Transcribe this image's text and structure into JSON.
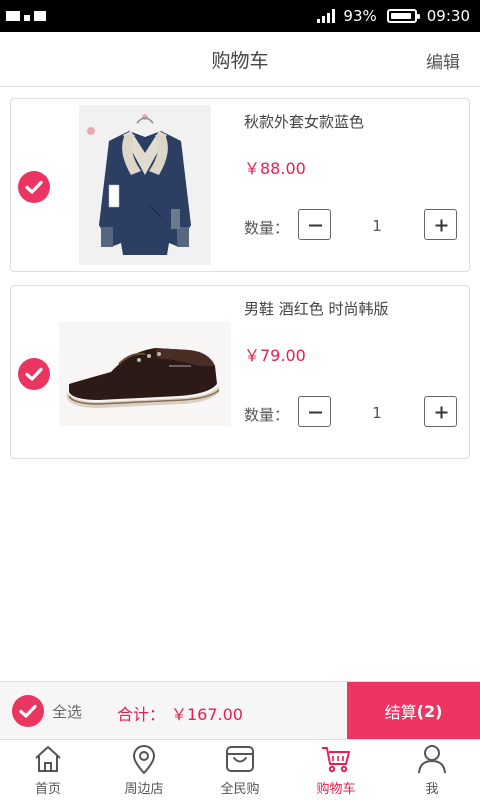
{
  "status_bar": {
    "battery_percent": "93%",
    "time": "09:30",
    "battery_level": 0.93
  },
  "header": {
    "title": "购物车",
    "edit_label": "编辑"
  },
  "cart": {
    "items": [
      {
        "name": "秋款外套女款蓝色",
        "price": "￥88.00",
        "quantity_label": "数量：",
        "quantity": "1",
        "checked": true,
        "image_icon": "blue-jacket-photo"
      },
      {
        "name": "男鞋 酒红色 时尚韩版",
        "price": "￥79.00",
        "quantity_label": "数量：",
        "quantity": "1",
        "checked": true,
        "image_icon": "brown-shoe-photo"
      }
    ]
  },
  "summary": {
    "select_all_label": "全选",
    "total_label": "合计：",
    "total_value": "￥167.00",
    "checkout_label": "结算",
    "checkout_count": "(2)"
  },
  "tabbar": {
    "tabs": [
      {
        "label": "首页",
        "icon": "home-icon",
        "active": false
      },
      {
        "label": "周边店",
        "icon": "location-pin-icon",
        "active": false
      },
      {
        "label": "全民购",
        "icon": "shopping-bag-icon",
        "active": false
      },
      {
        "label": "购物车",
        "icon": "cart-icon",
        "active": true
      },
      {
        "label": "我",
        "icon": "person-icon",
        "active": false
      }
    ]
  },
  "colors": {
    "accent": "#e8204f",
    "checkout_bg": "#ee3461",
    "check_bg": "#ea3561"
  }
}
